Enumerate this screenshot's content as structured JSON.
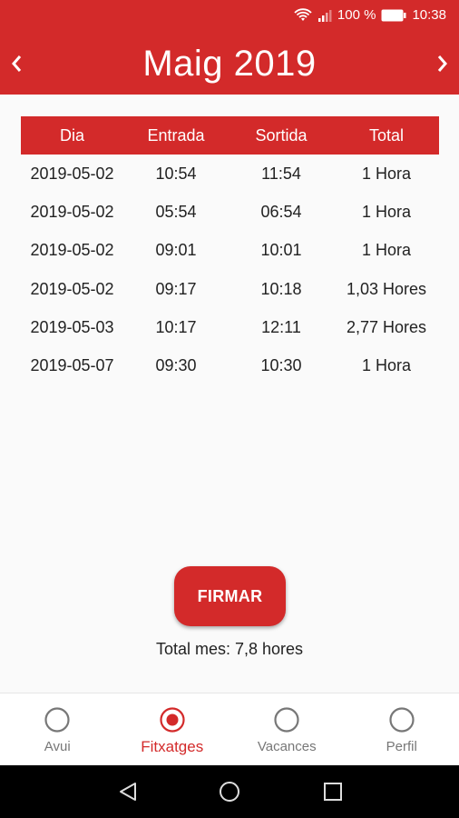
{
  "status_bar": {
    "battery": "100 %",
    "time": "10:38"
  },
  "header": {
    "title": "Maig 2019",
    "prev_icon": "chevron-left-icon",
    "next_icon": "chevron-right-icon"
  },
  "table": {
    "headers": [
      "Dia",
      "Entrada",
      "Sortida",
      "Total"
    ],
    "rows": [
      [
        "2019-05-02",
        "10:54",
        "11:54",
        "1 Hora"
      ],
      [
        "2019-05-02",
        "05:54",
        "06:54",
        "1 Hora"
      ],
      [
        "2019-05-02",
        "09:01",
        "10:01",
        "1 Hora"
      ],
      [
        "2019-05-02",
        "09:17",
        "10:18",
        "1,03 Hores"
      ],
      [
        "2019-05-03",
        "10:17",
        "12:11",
        "2,77 Hores"
      ],
      [
        "2019-05-07",
        "09:30",
        "10:30",
        "1 Hora"
      ]
    ]
  },
  "actions": {
    "firmar_label": "FIRMAR",
    "total_month": "Total mes: 7,8 hores"
  },
  "bottom_nav": {
    "tabs": [
      {
        "label": "Avui",
        "active": false
      },
      {
        "label": "Fitxatges",
        "active": true
      },
      {
        "label": "Vacances",
        "active": false
      },
      {
        "label": "Perfil",
        "active": false
      }
    ]
  },
  "colors": {
    "accent": "#d32a2a",
    "inactive": "#777777"
  }
}
